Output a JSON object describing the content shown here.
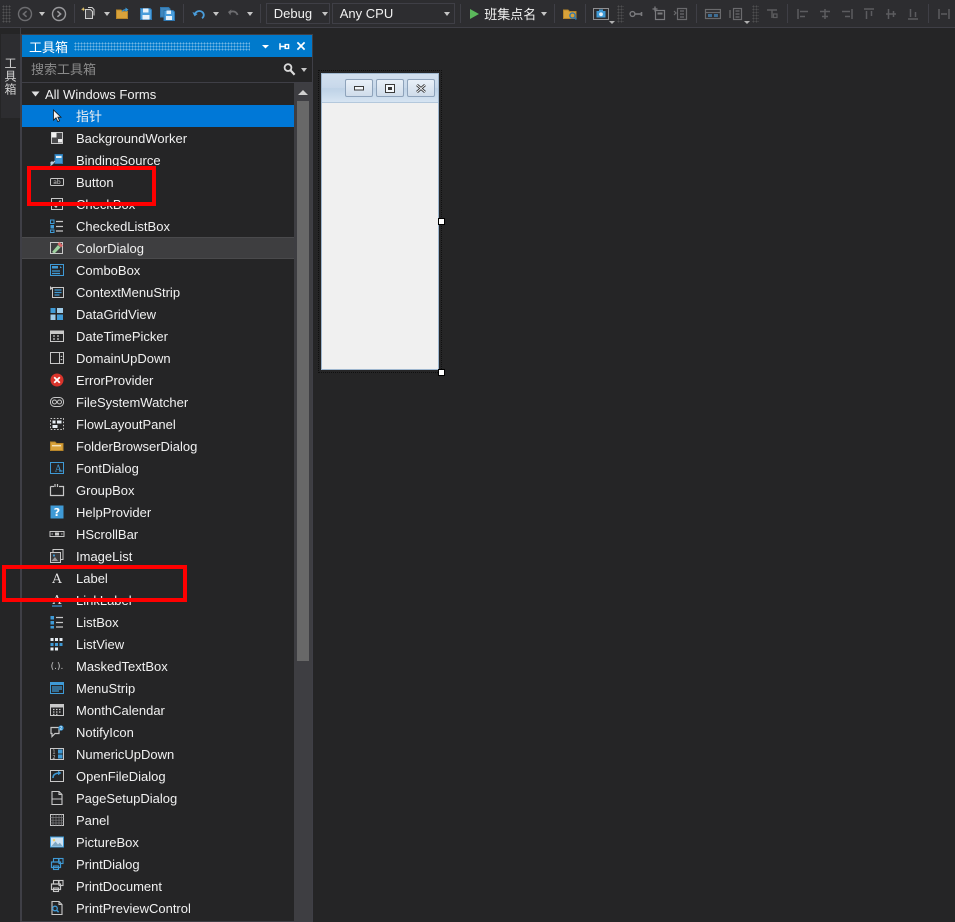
{
  "toolbar": {
    "nav_back": "navigate-back",
    "nav_forward": "navigate-forward",
    "new_project": "new-project",
    "open_file": "open-file",
    "save": "save",
    "save_all": "save-all",
    "undo": "undo",
    "redo": "redo",
    "config_value": "Debug",
    "platform_value": "Any CPU",
    "run_label": "班集点名",
    "icons": [
      "attach-to-process-icon",
      "screenshot-icon",
      "hot-reload-icon",
      "new-item-icon",
      "properties-window-icon",
      "tab-order-icon",
      "lock-controls-icon",
      "align-lefts-icon",
      "align-centers-icon",
      "align-rights-icon",
      "align-tops-icon",
      "align-middles-icon",
      "align-bottoms-icon",
      "make-same-width-icon"
    ]
  },
  "vtab": {
    "toolbox_label": "工具箱"
  },
  "toolbox": {
    "title": "工具箱",
    "search_placeholder": "搜索工具箱",
    "search_value": "",
    "dropdown_icon": "chevron-down-icon",
    "pin_icon": "pin-icon",
    "close_icon": "close-icon",
    "search_icon": "search-icon",
    "group_label": "All Windows Forms",
    "items": [
      {
        "label": "指针",
        "icon": "pointer-icon",
        "state": "selected"
      },
      {
        "label": "BackgroundWorker",
        "icon": "backgroundworker-icon",
        "state": "normal"
      },
      {
        "label": "BindingSource",
        "icon": "bindingsource-icon",
        "state": "normal"
      },
      {
        "label": "Button",
        "icon": "button-icon",
        "state": "normal"
      },
      {
        "label": "CheckBox",
        "icon": "checkbox-icon",
        "state": "normal"
      },
      {
        "label": "CheckedListBox",
        "icon": "checkedlistbox-icon",
        "state": "normal"
      },
      {
        "label": "ColorDialog",
        "icon": "colordialog-icon",
        "state": "hovered"
      },
      {
        "label": "ComboBox",
        "icon": "combobox-icon",
        "state": "normal"
      },
      {
        "label": "ContextMenuStrip",
        "icon": "contextmenustrip-icon",
        "state": "normal"
      },
      {
        "label": "DataGridView",
        "icon": "datagridview-icon",
        "state": "normal"
      },
      {
        "label": "DateTimePicker",
        "icon": "datetimepicker-icon",
        "state": "normal"
      },
      {
        "label": "DomainUpDown",
        "icon": "domainupdown-icon",
        "state": "normal"
      },
      {
        "label": "ErrorProvider",
        "icon": "errorprovider-icon",
        "state": "normal"
      },
      {
        "label": "FileSystemWatcher",
        "icon": "filesystemwatcher-icon",
        "state": "normal"
      },
      {
        "label": "FlowLayoutPanel",
        "icon": "flowlayoutpanel-icon",
        "state": "normal"
      },
      {
        "label": "FolderBrowserDialog",
        "icon": "folderbrowserdialog-icon",
        "state": "normal"
      },
      {
        "label": "FontDialog",
        "icon": "fontdialog-icon",
        "state": "normal"
      },
      {
        "label": "GroupBox",
        "icon": "groupbox-icon",
        "state": "normal"
      },
      {
        "label": "HelpProvider",
        "icon": "helpprovider-icon",
        "state": "normal"
      },
      {
        "label": "HScrollBar",
        "icon": "hscrollbar-icon",
        "state": "normal"
      },
      {
        "label": "ImageList",
        "icon": "imagelist-icon",
        "state": "normal"
      },
      {
        "label": "Label",
        "icon": "label-icon",
        "state": "normal"
      },
      {
        "label": "LinkLabel",
        "icon": "linklabel-icon",
        "state": "normal"
      },
      {
        "label": "ListBox",
        "icon": "listbox-icon",
        "state": "normal"
      },
      {
        "label": "ListView",
        "icon": "listview-icon",
        "state": "normal"
      },
      {
        "label": "MaskedTextBox",
        "icon": "maskedtextbox-icon",
        "state": "normal"
      },
      {
        "label": "MenuStrip",
        "icon": "menustrip-icon",
        "state": "normal"
      },
      {
        "label": "MonthCalendar",
        "icon": "monthcalendar-icon",
        "state": "normal"
      },
      {
        "label": "NotifyIcon",
        "icon": "notifyicon-icon",
        "state": "normal"
      },
      {
        "label": "NumericUpDown",
        "icon": "numericupdown-icon",
        "state": "normal"
      },
      {
        "label": "OpenFileDialog",
        "icon": "openfiledialog-icon",
        "state": "normal"
      },
      {
        "label": "PageSetupDialog",
        "icon": "pagesetupdialog-icon",
        "state": "normal"
      },
      {
        "label": "Panel",
        "icon": "panel-icon",
        "state": "normal"
      },
      {
        "label": "PictureBox",
        "icon": "picturebox-icon",
        "state": "normal"
      },
      {
        "label": "PrintDialog",
        "icon": "printdialog-icon",
        "state": "normal"
      },
      {
        "label": "PrintDocument",
        "icon": "printdocument-icon",
        "state": "normal"
      },
      {
        "label": "PrintPreviewControl",
        "icon": "printpreviewcontrol-icon",
        "state": "normal"
      }
    ]
  },
  "designer": {
    "form": {
      "minimize_icon": "minimize-icon",
      "maximize_icon": "maximize-icon",
      "close_icon": "close-icon"
    }
  },
  "annotations": [
    {
      "name": "button-highlight",
      "color": "#ff0000"
    },
    {
      "name": "label-highlight",
      "color": "#ff0000"
    }
  ],
  "colors": {
    "accent": "#007acc",
    "selection": "#0078d7",
    "chrome": "#2d2d30",
    "panel": "#252526",
    "annotation": "#ff0000"
  }
}
